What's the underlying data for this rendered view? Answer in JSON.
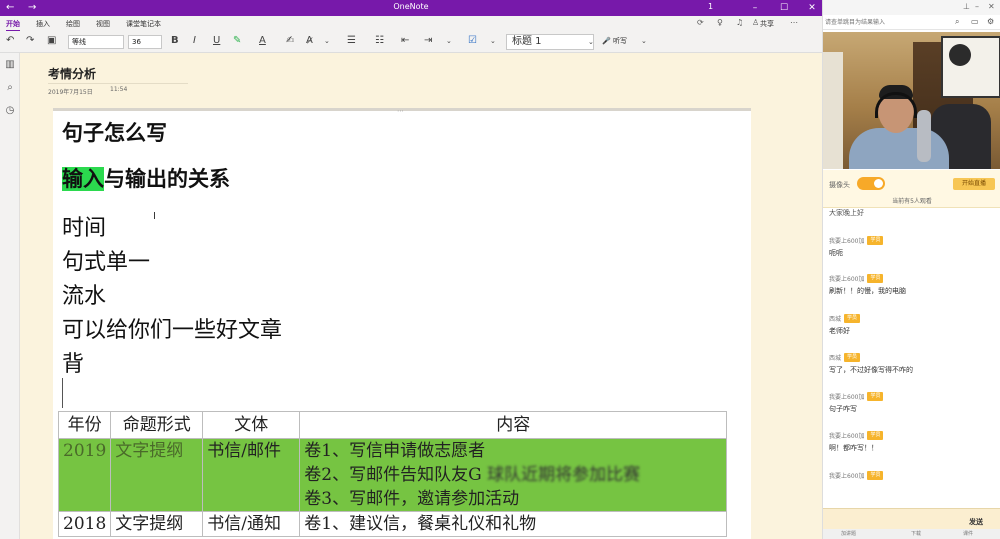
{
  "onenote": {
    "window_title": "OneNote",
    "page_number": "1",
    "titlebar_icons": [
      "back-arrow-icon",
      "forward-arrow-icon",
      "minimize-icon",
      "maximize-icon",
      "close-icon"
    ],
    "menu": [
      "开始",
      "插入",
      "绘图",
      "视图",
      "课堂笔记本"
    ],
    "share_label": "共享",
    "ribbon": {
      "font_name": "等线",
      "font_size": "36",
      "bold": "B",
      "italic": "I",
      "underline": "U",
      "style": "标题 1",
      "dictate": "听写"
    },
    "page": {
      "title": "考情分析",
      "date": "2019年7月15日",
      "time": "11:54",
      "heading1": "句子怎么写",
      "heading2_highlight": "输入",
      "heading2_rest": "与输出的关系",
      "lines": [
        "时间",
        "句式单一",
        "流水",
        "可以给你们一些好文章",
        "背"
      ]
    },
    "table": {
      "headers": [
        "年份",
        "命题形式",
        "文体",
        "内容"
      ],
      "rows": [
        {
          "year": "2019",
          "form": "文字提纲",
          "genre": "书信/邮件",
          "content": [
            "卷1、写信申请做志愿者",
            "卷2、写邮件告知队友G",
            "球队近期将参加比赛",
            "卷3、写邮件，邀请参加活动"
          ]
        },
        {
          "year": "2018",
          "form": "文字提纲",
          "genre": "书信/通知",
          "content": [
            "卷1、建议信，餐桌礼仪和礼物"
          ]
        }
      ]
    }
  },
  "live": {
    "search_placeholder": "请查单跳目为结果输入",
    "camera_label": "摄像头",
    "start_live": "开始直播",
    "watching": "当前有5人观看",
    "partial_message": "大家晚上好",
    "messages": [
      {
        "user": "我要上600加",
        "badge": "学员",
        "text": "呃呃"
      },
      {
        "user": "我要上600加",
        "badge": "学员",
        "text": "刷新！！的慢，我的电脑"
      },
      {
        "user": "西城",
        "badge": "学员",
        "text": "老师好"
      },
      {
        "user": "西城",
        "badge": "学员",
        "text": "写了，不过好像写得不咋的"
      },
      {
        "user": "我要上600加",
        "badge": "学员",
        "text": "句子咋写"
      },
      {
        "user": "我要上600加",
        "badge": "学员",
        "text": "啊！都咋写！！"
      },
      {
        "user": "我要上600加",
        "badge": "学员",
        "text": ""
      }
    ],
    "send_label": "发送",
    "status_items": [
      "加讲题",
      "下载",
      "课件"
    ]
  }
}
